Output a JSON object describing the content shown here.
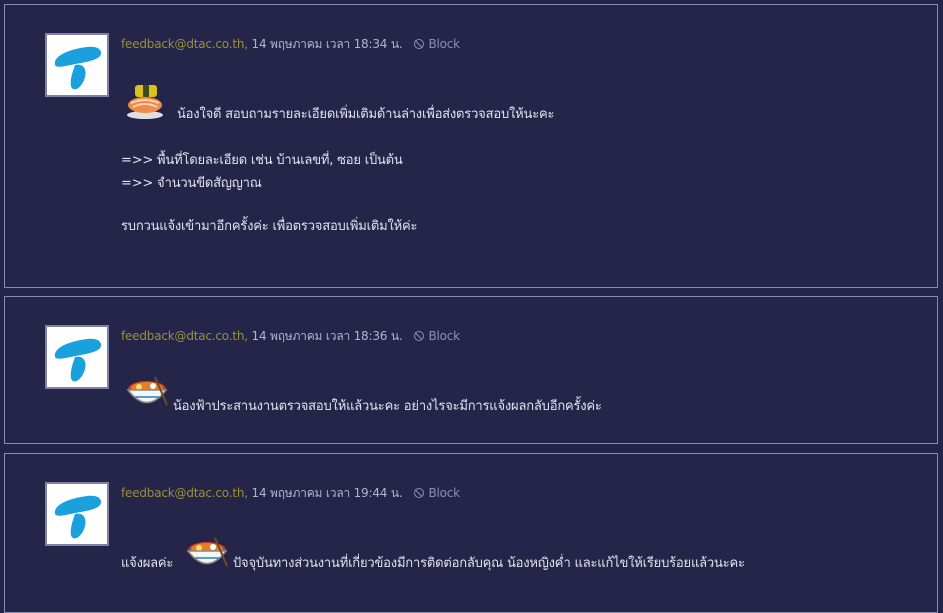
{
  "posts": [
    {
      "email": "feedback@dtac.co.th,",
      "date": " 14 พฤษภาคม เวลา 18:34 น.",
      "block_label": "Block",
      "avatar_icon": "dtac-logo-icon",
      "emoji_icon": "sushi-emoticon-icon",
      "lines": [
        "น้องใจดี สอบถามรายละเอียดเพิ่มเติมด้านล่างเพื่อส่งตรวจสอบให้นะคะ",
        "=>> พื้นที่โดยละเอียด เช่น บ้านเลขที่, ซอย เป็นต้น",
        "=>> จำนวนขีดสัญญาณ",
        "รบกวนแจ้งเข้ามาอีกครั้งค่ะ เพื่อตรวจสอบเพิ่มเติมให้ค่ะ"
      ]
    },
    {
      "email": "feedback@dtac.co.th,",
      "date": " 14 พฤษภาคม เวลา 18:36 น.",
      "block_label": "Block",
      "avatar_icon": "dtac-logo-icon",
      "emoji_icon": "noodle-bowl-emoticon-icon",
      "lines": [
        "น้องฟ้าประสานงานตรวจสอบให้แล้วนะคะ อย่างไรจะมีการแจ้งผลกลับอีกครั้งค่ะ"
      ]
    },
    {
      "email": "feedback@dtac.co.th,",
      "date": " 14 พฤษภาคม เวลา 19:44 น.",
      "block_label": "Block",
      "avatar_icon": "dtac-logo-icon",
      "emoji_icon": "noodle-bowl-emoticon-icon",
      "lines": [
        "แจ้งผลค่ะ",
        "ปัจจุบันทางส่วนงานที่เกี่ยวข้องมีการติดต่อกลับคุณ น้องหญิงค่ำ และแก้ไขให้เรียบร้อยแล้วนะคะ"
      ]
    }
  ],
  "colors": {
    "background": "#22244a",
    "email": "#9a8f3a",
    "text": "#e2e2ee",
    "border": "#8a8cad",
    "logo": "#1aa0dc"
  }
}
